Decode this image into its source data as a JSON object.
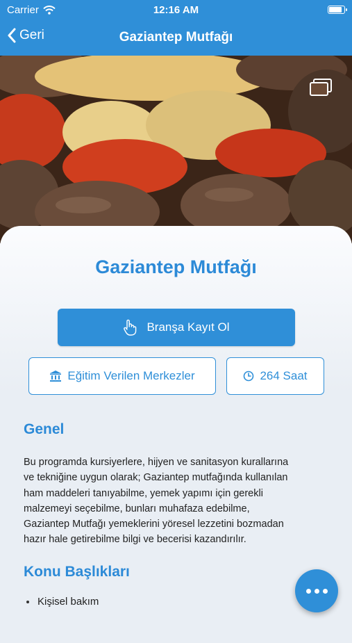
{
  "status": {
    "carrier": "Carrier",
    "time": "12:16 AM",
    "battery_level": 0.95
  },
  "nav": {
    "back_label": "Geri",
    "title": "Gaziantep Mutfağı"
  },
  "hero": {
    "gallery_icon": "gallery-icon"
  },
  "course": {
    "title": "Gaziantep Mutfağı",
    "register_label": "Branşa Kayıt Ol",
    "centers_label": "Eğitim Verilen Merkezler",
    "hours_label": "264 Saat"
  },
  "general": {
    "heading": "Genel",
    "lines": [
      "Bu programda kursiyerlere, hijyen ve sanitasyon kurallarına",
      "ve tekniğine uygun olarak; Gaziantep mutfağında kullanılan",
      "ham maddeleri tanıyabilme, yemek yapımı için gerekli",
      "malzemeyi seçebilme, bunları muhafaza edebilme,",
      "Gaziantep Mutfağı yemeklerini yöresel lezzetini bozmadan",
      "hazır hale getirebilme bilgi ve becerisi kazandırılır."
    ]
  },
  "topics": {
    "heading": "Konu Başlıkları",
    "items": [
      "Kişisel bakım"
    ]
  },
  "colors": {
    "primary": "#2f8fd8",
    "heading": "#2c8ad7"
  }
}
